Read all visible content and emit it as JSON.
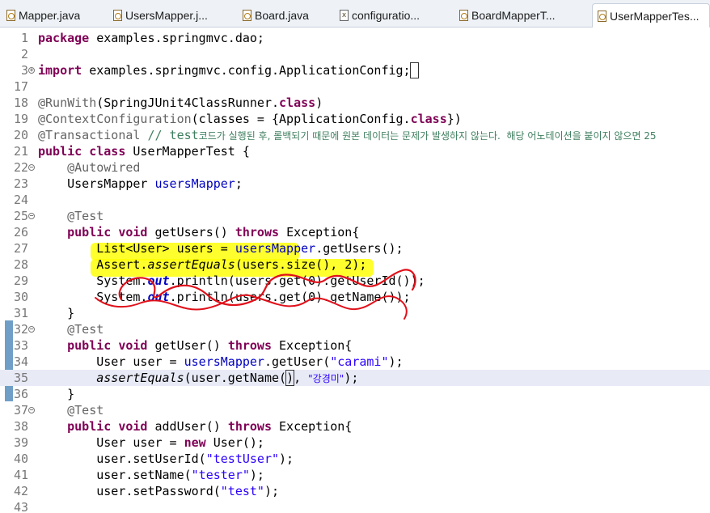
{
  "tabs": [
    {
      "label": "Mapper.java",
      "icon": "java-file-icon"
    },
    {
      "label": "UsersMapper.j...",
      "icon": "java-file-icon"
    },
    {
      "label": "Board.java",
      "icon": "java-file-icon"
    },
    {
      "label": "configuratio...",
      "icon": "xml-file-icon"
    },
    {
      "label": "BoardMapperT...",
      "icon": "java-file-icon"
    },
    {
      "label": "UserMapperTes...",
      "icon": "java-file-icon"
    }
  ],
  "editor": {
    "lines": [
      {
        "n": "1",
        "tokens": [
          {
            "t": "package ",
            "c": "kw"
          },
          {
            "t": "examples.springmvc.dao;"
          }
        ]
      },
      {
        "n": "2",
        "tokens": []
      },
      {
        "n": "3",
        "tokens": [
          {
            "t": "import ",
            "c": "kw"
          },
          {
            "t": "examples.springmvc.config.ApplicationConfig;"
          },
          {
            "t": " ",
            "c": "boxmark"
          }
        ]
      },
      {
        "n": "17",
        "tokens": []
      },
      {
        "n": "18",
        "tokens": [
          {
            "t": "@RunWith",
            "c": "an"
          },
          {
            "t": "(SpringJUnit4ClassRunner."
          },
          {
            "t": "class",
            "c": "kw"
          },
          {
            "t": ")"
          }
        ]
      },
      {
        "n": "19",
        "tokens": [
          {
            "t": "@ContextConfiguration",
            "c": "an"
          },
          {
            "t": "(classes = {ApplicationConfig."
          },
          {
            "t": "class",
            "c": "kw"
          },
          {
            "t": "})"
          }
        ]
      },
      {
        "n": "20",
        "tokens": [
          {
            "t": "@Transactional",
            "c": "an"
          },
          {
            "t": " // test",
            "c": "cm"
          },
          {
            "t": "코드가 실행된 후, 롤백되기 때문에 원본 데이터는 문제가 발생하지 않는다.  해당 어노테이션을 붙이지 않으면 25",
            "c": "cmk"
          }
        ]
      },
      {
        "n": "21",
        "tokens": [
          {
            "t": "public class ",
            "c": "kw"
          },
          {
            "t": "UserMapperTest {"
          }
        ]
      },
      {
        "n": "22",
        "tokens": [
          {
            "t": "    "
          },
          {
            "t": "@Autowired",
            "c": "an"
          }
        ]
      },
      {
        "n": "23",
        "tokens": [
          {
            "t": "    UsersMapper "
          },
          {
            "t": "usersMapper",
            "c": "fd"
          },
          {
            "t": ";"
          }
        ]
      },
      {
        "n": "24",
        "tokens": []
      },
      {
        "n": "25",
        "tokens": [
          {
            "t": "    "
          },
          {
            "t": "@Test",
            "c": "an"
          }
        ]
      },
      {
        "n": "26",
        "tokens": [
          {
            "t": "    "
          },
          {
            "t": "public void ",
            "c": "kw"
          },
          {
            "t": "getUsers() "
          },
          {
            "t": "throws ",
            "c": "kw"
          },
          {
            "t": "Exception{"
          }
        ]
      },
      {
        "n": "27",
        "tokens": [
          {
            "t": "        List<User> users = "
          },
          {
            "t": "usersMapper",
            "c": "fd"
          },
          {
            "t": ".getUsers();"
          }
        ]
      },
      {
        "n": "28",
        "tokens": [
          {
            "t": "        Assert."
          },
          {
            "t": "assertEquals",
            "c": "it"
          },
          {
            "t": "(users.size(), 2);"
          }
        ]
      },
      {
        "n": "29",
        "tokens": [
          {
            "t": "        System."
          },
          {
            "t": "out",
            "c": "sf"
          },
          {
            "t": ".println(users.get(0).getUserId());"
          }
        ]
      },
      {
        "n": "30",
        "tokens": [
          {
            "t": "        System."
          },
          {
            "t": "out",
            "c": "sf"
          },
          {
            "t": ".println(users.get(0).getName());"
          }
        ]
      },
      {
        "n": "31",
        "tokens": [
          {
            "t": "    }"
          }
        ]
      },
      {
        "n": "32",
        "tokens": [
          {
            "t": "    "
          },
          {
            "t": "@Test",
            "c": "an"
          }
        ]
      },
      {
        "n": "33",
        "tokens": [
          {
            "t": "    "
          },
          {
            "t": "public void ",
            "c": "kw"
          },
          {
            "t": "getUser() "
          },
          {
            "t": "throws ",
            "c": "kw"
          },
          {
            "t": "Exception{"
          }
        ]
      },
      {
        "n": "34",
        "tokens": [
          {
            "t": "        User user = "
          },
          {
            "t": "usersMapper",
            "c": "fd"
          },
          {
            "t": ".getUser("
          },
          {
            "t": "\"carami\"",
            "c": "st"
          },
          {
            "t": ");"
          }
        ]
      },
      {
        "n": "35",
        "tokens": [
          {
            "t": "        "
          },
          {
            "t": "assertEquals",
            "c": "it"
          },
          {
            "t": "(user.getName("
          },
          {
            "t": ")",
            "c": "boxmark"
          },
          {
            "t": ", "
          },
          {
            "t": "\"강경미\"",
            "c": "stk"
          },
          {
            "t": ");"
          }
        ]
      },
      {
        "n": "36",
        "tokens": [
          {
            "t": "    }"
          }
        ]
      },
      {
        "n": "37",
        "tokens": [
          {
            "t": "    "
          },
          {
            "t": "@Test",
            "c": "an"
          }
        ]
      },
      {
        "n": "38",
        "tokens": [
          {
            "t": "    "
          },
          {
            "t": "public void ",
            "c": "kw"
          },
          {
            "t": "addUser() "
          },
          {
            "t": "throws ",
            "c": "kw"
          },
          {
            "t": "Exception{"
          }
        ]
      },
      {
        "n": "39",
        "tokens": [
          {
            "t": "        User user = "
          },
          {
            "t": "new ",
            "c": "kw"
          },
          {
            "t": "User();"
          }
        ]
      },
      {
        "n": "40",
        "tokens": [
          {
            "t": "        user.setUserId("
          },
          {
            "t": "\"testUser\"",
            "c": "st"
          },
          {
            "t": ");"
          }
        ]
      },
      {
        "n": "41",
        "tokens": [
          {
            "t": "        user.setName("
          },
          {
            "t": "\"tester\"",
            "c": "st"
          },
          {
            "t": ");"
          }
        ]
      },
      {
        "n": "42",
        "tokens": [
          {
            "t": "        user.setPassword("
          },
          {
            "t": "\"test\"",
            "c": "st"
          },
          {
            "t": ");"
          }
        ]
      },
      {
        "n": "43",
        "tokens": []
      }
    ]
  }
}
